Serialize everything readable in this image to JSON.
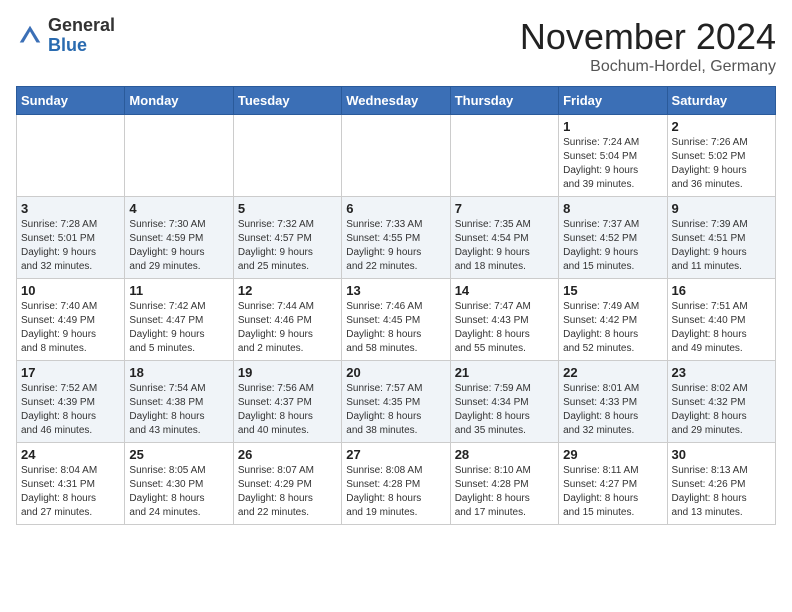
{
  "header": {
    "logo_general": "General",
    "logo_blue": "Blue",
    "month_title": "November 2024",
    "location": "Bochum-Hordel, Germany"
  },
  "weekdays": [
    "Sunday",
    "Monday",
    "Tuesday",
    "Wednesday",
    "Thursday",
    "Friday",
    "Saturday"
  ],
  "weeks": [
    [
      {
        "day": "",
        "info": ""
      },
      {
        "day": "",
        "info": ""
      },
      {
        "day": "",
        "info": ""
      },
      {
        "day": "",
        "info": ""
      },
      {
        "day": "",
        "info": ""
      },
      {
        "day": "1",
        "info": "Sunrise: 7:24 AM\nSunset: 5:04 PM\nDaylight: 9 hours\nand 39 minutes."
      },
      {
        "day": "2",
        "info": "Sunrise: 7:26 AM\nSunset: 5:02 PM\nDaylight: 9 hours\nand 36 minutes."
      }
    ],
    [
      {
        "day": "3",
        "info": "Sunrise: 7:28 AM\nSunset: 5:01 PM\nDaylight: 9 hours\nand 32 minutes."
      },
      {
        "day": "4",
        "info": "Sunrise: 7:30 AM\nSunset: 4:59 PM\nDaylight: 9 hours\nand 29 minutes."
      },
      {
        "day": "5",
        "info": "Sunrise: 7:32 AM\nSunset: 4:57 PM\nDaylight: 9 hours\nand 25 minutes."
      },
      {
        "day": "6",
        "info": "Sunrise: 7:33 AM\nSunset: 4:55 PM\nDaylight: 9 hours\nand 22 minutes."
      },
      {
        "day": "7",
        "info": "Sunrise: 7:35 AM\nSunset: 4:54 PM\nDaylight: 9 hours\nand 18 minutes."
      },
      {
        "day": "8",
        "info": "Sunrise: 7:37 AM\nSunset: 4:52 PM\nDaylight: 9 hours\nand 15 minutes."
      },
      {
        "day": "9",
        "info": "Sunrise: 7:39 AM\nSunset: 4:51 PM\nDaylight: 9 hours\nand 11 minutes."
      }
    ],
    [
      {
        "day": "10",
        "info": "Sunrise: 7:40 AM\nSunset: 4:49 PM\nDaylight: 9 hours\nand 8 minutes."
      },
      {
        "day": "11",
        "info": "Sunrise: 7:42 AM\nSunset: 4:47 PM\nDaylight: 9 hours\nand 5 minutes."
      },
      {
        "day": "12",
        "info": "Sunrise: 7:44 AM\nSunset: 4:46 PM\nDaylight: 9 hours\nand 2 minutes."
      },
      {
        "day": "13",
        "info": "Sunrise: 7:46 AM\nSunset: 4:45 PM\nDaylight: 8 hours\nand 58 minutes."
      },
      {
        "day": "14",
        "info": "Sunrise: 7:47 AM\nSunset: 4:43 PM\nDaylight: 8 hours\nand 55 minutes."
      },
      {
        "day": "15",
        "info": "Sunrise: 7:49 AM\nSunset: 4:42 PM\nDaylight: 8 hours\nand 52 minutes."
      },
      {
        "day": "16",
        "info": "Sunrise: 7:51 AM\nSunset: 4:40 PM\nDaylight: 8 hours\nand 49 minutes."
      }
    ],
    [
      {
        "day": "17",
        "info": "Sunrise: 7:52 AM\nSunset: 4:39 PM\nDaylight: 8 hours\nand 46 minutes."
      },
      {
        "day": "18",
        "info": "Sunrise: 7:54 AM\nSunset: 4:38 PM\nDaylight: 8 hours\nand 43 minutes."
      },
      {
        "day": "19",
        "info": "Sunrise: 7:56 AM\nSunset: 4:37 PM\nDaylight: 8 hours\nand 40 minutes."
      },
      {
        "day": "20",
        "info": "Sunrise: 7:57 AM\nSunset: 4:35 PM\nDaylight: 8 hours\nand 38 minutes."
      },
      {
        "day": "21",
        "info": "Sunrise: 7:59 AM\nSunset: 4:34 PM\nDaylight: 8 hours\nand 35 minutes."
      },
      {
        "day": "22",
        "info": "Sunrise: 8:01 AM\nSunset: 4:33 PM\nDaylight: 8 hours\nand 32 minutes."
      },
      {
        "day": "23",
        "info": "Sunrise: 8:02 AM\nSunset: 4:32 PM\nDaylight: 8 hours\nand 29 minutes."
      }
    ],
    [
      {
        "day": "24",
        "info": "Sunrise: 8:04 AM\nSunset: 4:31 PM\nDaylight: 8 hours\nand 27 minutes."
      },
      {
        "day": "25",
        "info": "Sunrise: 8:05 AM\nSunset: 4:30 PM\nDaylight: 8 hours\nand 24 minutes."
      },
      {
        "day": "26",
        "info": "Sunrise: 8:07 AM\nSunset: 4:29 PM\nDaylight: 8 hours\nand 22 minutes."
      },
      {
        "day": "27",
        "info": "Sunrise: 8:08 AM\nSunset: 4:28 PM\nDaylight: 8 hours\nand 19 minutes."
      },
      {
        "day": "28",
        "info": "Sunrise: 8:10 AM\nSunset: 4:28 PM\nDaylight: 8 hours\nand 17 minutes."
      },
      {
        "day": "29",
        "info": "Sunrise: 8:11 AM\nSunset: 4:27 PM\nDaylight: 8 hours\nand 15 minutes."
      },
      {
        "day": "30",
        "info": "Sunrise: 8:13 AM\nSunset: 4:26 PM\nDaylight: 8 hours\nand 13 minutes."
      }
    ]
  ]
}
